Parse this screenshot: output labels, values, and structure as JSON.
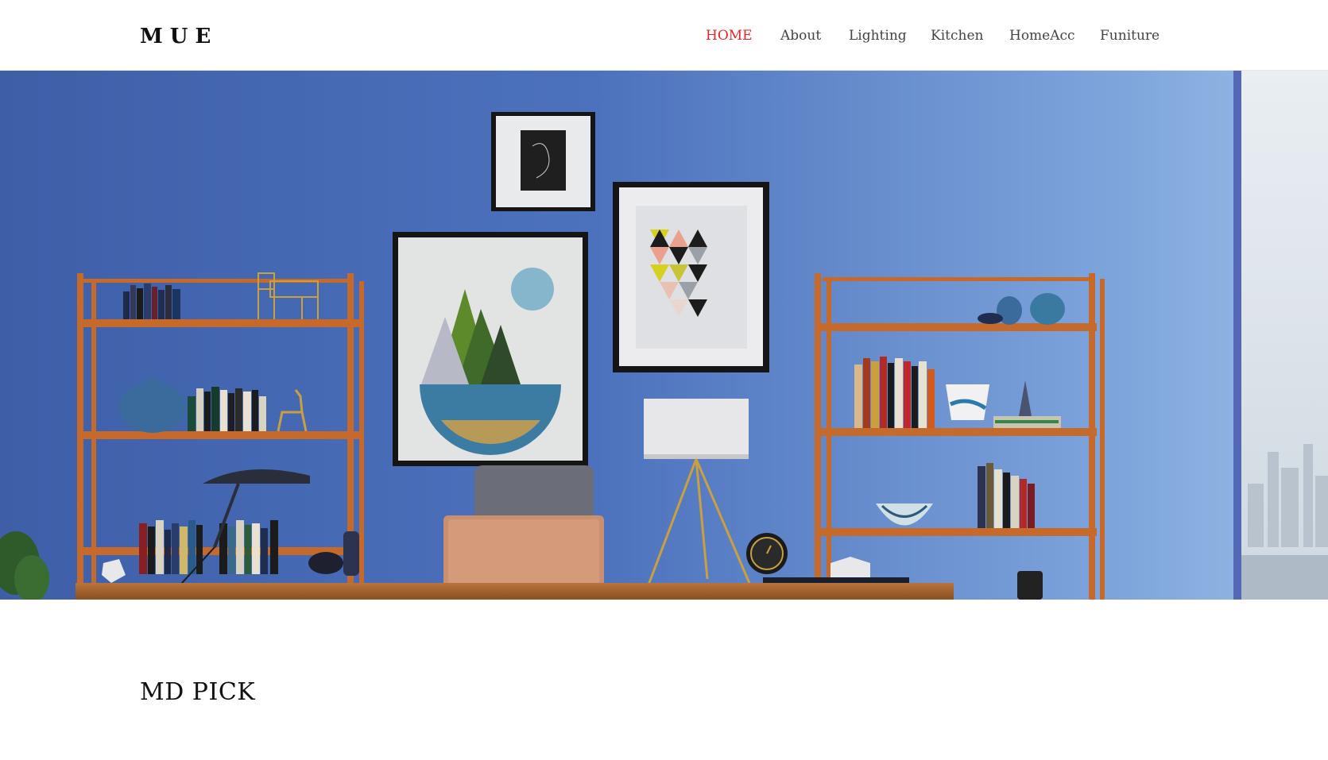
{
  "header": {
    "logo": "MUE",
    "nav": [
      {
        "label": "HOME",
        "active": true
      },
      {
        "label": "About",
        "active": false
      },
      {
        "label": "Lighting",
        "active": false
      },
      {
        "label": "Kitchen",
        "active": false
      },
      {
        "label": "HomeAcc",
        "active": false
      },
      {
        "label": "Funiture",
        "active": false
      }
    ]
  },
  "hero": {
    "wall_color": "#4f73bd",
    "shelf_color": "#c7692b"
  },
  "main": {
    "section_title": "MD PICK"
  },
  "colors": {
    "accent": "#e5252a",
    "text": "#111111",
    "nav_text": "#444444"
  }
}
